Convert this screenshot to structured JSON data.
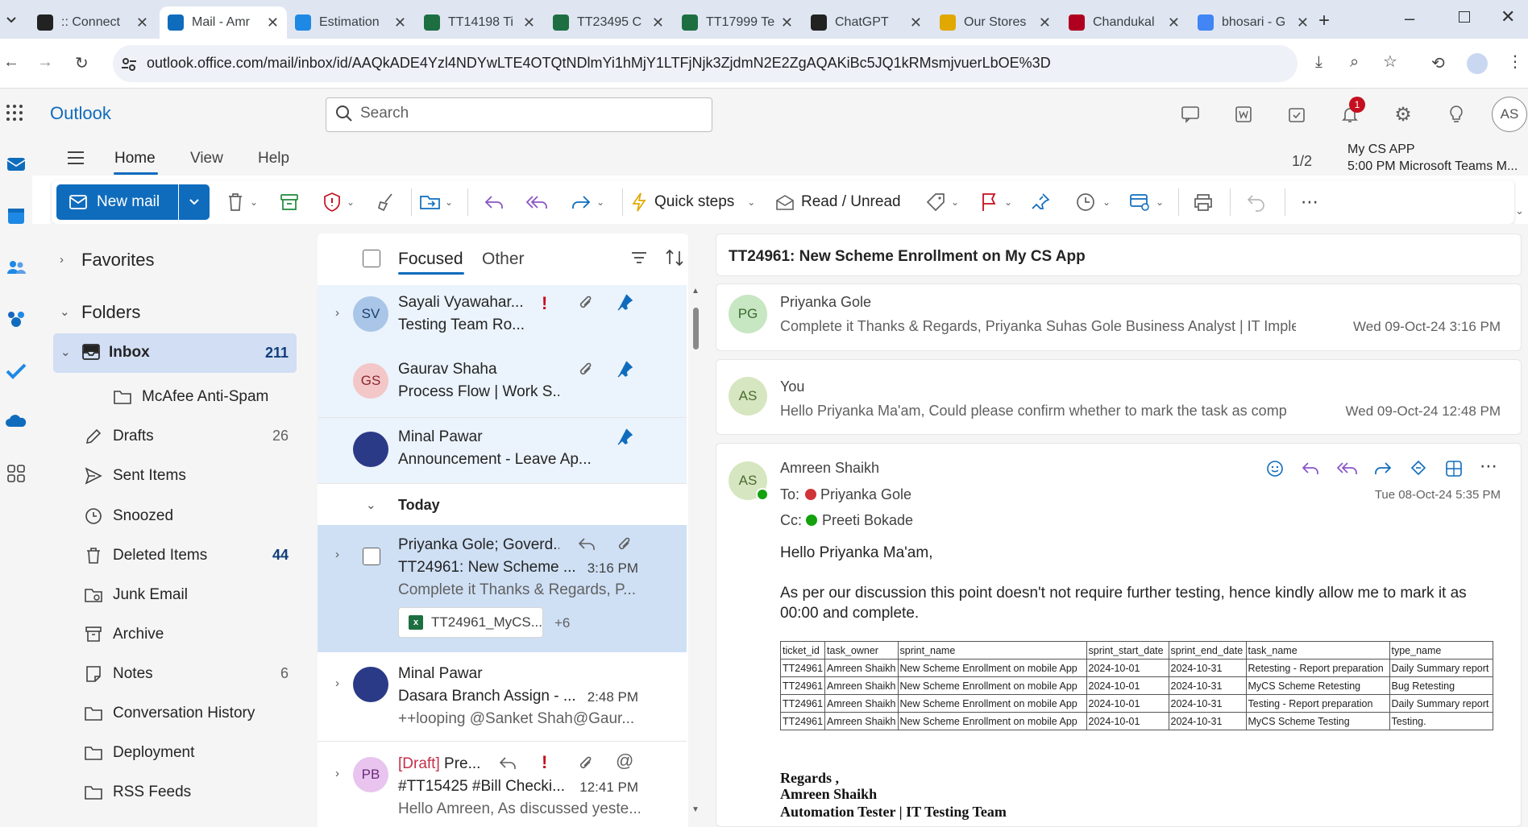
{
  "browser": {
    "tabs": [
      {
        "label": ":: Connect",
        "icon": "react-icon",
        "color": "#222222"
      },
      {
        "label": "Mail - Amr",
        "icon": "outlook-icon",
        "color": "#0f6cbd"
      },
      {
        "label": "Estimation",
        "icon": "onedrive-icon",
        "color": "#1e88e5"
      },
      {
        "label": "TT14198 Ti",
        "icon": "excel-icon",
        "color": "#1d6f42"
      },
      {
        "label": "TT23495 C",
        "icon": "excel-icon",
        "color": "#1d6f42"
      },
      {
        "label": "TT17999 Te",
        "icon": "excel-icon",
        "color": "#1d6f42"
      },
      {
        "label": "ChatGPT",
        "icon": "chatgpt-icon",
        "color": "#222222"
      },
      {
        "label": "Our Stores",
        "icon": "store-icon",
        "color": "#e0a800"
      },
      {
        "label": "Chandukal",
        "icon": "cs-icon",
        "color": "#b00020"
      },
      {
        "label": "bhosari - G",
        "icon": "google-icon",
        "color": "#4285f4"
      }
    ],
    "url": "outlook.office.com/mail/inbox/id/AAQkADE4Yzl4NDYwLTE4OTQtNDlmYi1hMjY1LTFjNjk3ZjdmN2E2ZgAQAKiBc5JQ1kRMsmjvuerLbOE%3D"
  },
  "outlook": {
    "brand": "Outlook",
    "search_placeholder": "Search",
    "notification_count": "1",
    "user_initials": "AS"
  },
  "ribbon": {
    "tabs": [
      "Home",
      "View",
      "Help"
    ],
    "new_mail": "New mail",
    "quick_steps": "Quick steps",
    "read_unread": "Read / Unread",
    "reminder_count": "1/2",
    "reminder_title": "My CS APP",
    "reminder_detail": "5:00 PM Microsoft Teams M..."
  },
  "folders": {
    "favorites": "Favorites",
    "folders": "Folders",
    "inbox": {
      "label": "Inbox",
      "count": "211"
    },
    "items": [
      {
        "label": "McAfee Anti-Spam",
        "count": ""
      },
      {
        "label": "Drafts",
        "count": "26"
      },
      {
        "label": "Sent Items",
        "count": ""
      },
      {
        "label": "Snoozed",
        "count": ""
      },
      {
        "label": "Deleted Items",
        "count": "44"
      },
      {
        "label": "Junk Email",
        "count": ""
      },
      {
        "label": "Archive",
        "count": ""
      },
      {
        "label": "Notes",
        "count": "6"
      },
      {
        "label": "Conversation History",
        "count": ""
      },
      {
        "label": "Deployment",
        "count": ""
      },
      {
        "label": "RSS Feeds",
        "count": ""
      }
    ]
  },
  "list": {
    "focused": "Focused",
    "other": "Other",
    "today": "Today",
    "messages": [
      {
        "initials": "SV",
        "sender": "Sayali Vyawahar...",
        "subject": "Testing Team Ro...",
        "avatar_color": "#a9c6e8"
      },
      {
        "initials": "GS",
        "sender": "Gaurav Shaha",
        "subject": "Process Flow | Work S...",
        "avatar_color": "#f3c6c8"
      },
      {
        "initials": "",
        "sender": "Minal Pawar",
        "subject": "Announcement - Leave Ap...",
        "avatar_color": "#2b3a86"
      },
      {
        "initials": "",
        "sender": "Priyanka Gole; Goverd...",
        "subject": "TT24961: New Scheme ...",
        "time": "3:16 PM",
        "preview": "Complete it Thanks & Regards, P...",
        "attachment": "TT24961_MyCS...",
        "more": "+6"
      },
      {
        "initials": "",
        "sender": "Minal Pawar",
        "subject": "Dasara Branch Assign - ...",
        "time": "2:48 PM",
        "preview": "++looping @Sanket Shah@Gaur...",
        "avatar_color": "#2b3a86"
      },
      {
        "initials": "PB",
        "draft_tag": "[Draft]",
        "sender": "Pre...",
        "subject": "#TT15425 #Bill Checki...",
        "time": "12:41 PM",
        "preview": "Hello Amreen, As discussed yeste...",
        "avatar_color": "#e8c4ef"
      }
    ]
  },
  "reading": {
    "subject": "TT24961: New Scheme Enrollment on My CS App",
    "thread": [
      {
        "initials": "PG",
        "name": "Priyanka Gole",
        "preview": "Complete it Thanks & Regards, Priyanka Suhas Gole Business Analyst | IT Implem...",
        "date": "Wed 09-Oct-24 3:16 PM",
        "avatar_color": "#c7e6c2"
      },
      {
        "initials": "AS",
        "name": "You",
        "preview": "Hello Priyanka Ma'am, Could please confirm whether to mark the task as compl...",
        "date": "Wed 09-Oct-24 12:48 PM",
        "avatar_color": "#d6e6c0"
      }
    ],
    "open": {
      "initials": "AS",
      "name": "Amreen Shaikh",
      "to_label": "To:",
      "to": "Priyanka Gole",
      "cc_label": "Cc:",
      "cc": "Preeti Bokade",
      "date": "Tue 08-Oct-24 5:35 PM",
      "greeting": "Hello Priyanka Ma'am,",
      "body": "As per our discussion this point doesn't not require further testing, hence kindly allow me to mark it as 00:00 and complete.",
      "table_headers": [
        "ticket_id",
        "task_owner",
        "sprint_name",
        "sprint_start_date",
        "sprint_end_date",
        "task_name",
        "type_name"
      ],
      "table_rows": [
        [
          "TT24961",
          "Amreen Shaikh",
          "New Scheme Enrollment on mobile App",
          "2024-10-01",
          "2024-10-31",
          "Retesting - Report preparation",
          "Daily Summary report"
        ],
        [
          "TT24961",
          "Amreen Shaikh",
          "New Scheme Enrollment on mobile App",
          "2024-10-01",
          "2024-10-31",
          "MyCS Scheme Retesting",
          "Bug Retesting"
        ],
        [
          "TT24961",
          "Amreen Shaikh",
          "New Scheme Enrollment on mobile App",
          "2024-10-01",
          "2024-10-31",
          "Testing - Report preparation",
          "Daily Summary report"
        ],
        [
          "TT24961",
          "Amreen Shaikh",
          "New Scheme Enrollment on mobile App",
          "2024-10-01",
          "2024-10-31",
          "MyCS Scheme Testing",
          "Testing."
        ]
      ],
      "sig_regards": "Regards ,",
      "sig_name": "Amreen Shaikh",
      "sig_title": "Automation Tester | IT Testing Team"
    }
  },
  "colors": {
    "accent": "#0f6cbd",
    "selected": "#cfe0f5",
    "pinned": "#ebf3fc",
    "danger": "#c50f1f",
    "draft": "#c4314b"
  }
}
